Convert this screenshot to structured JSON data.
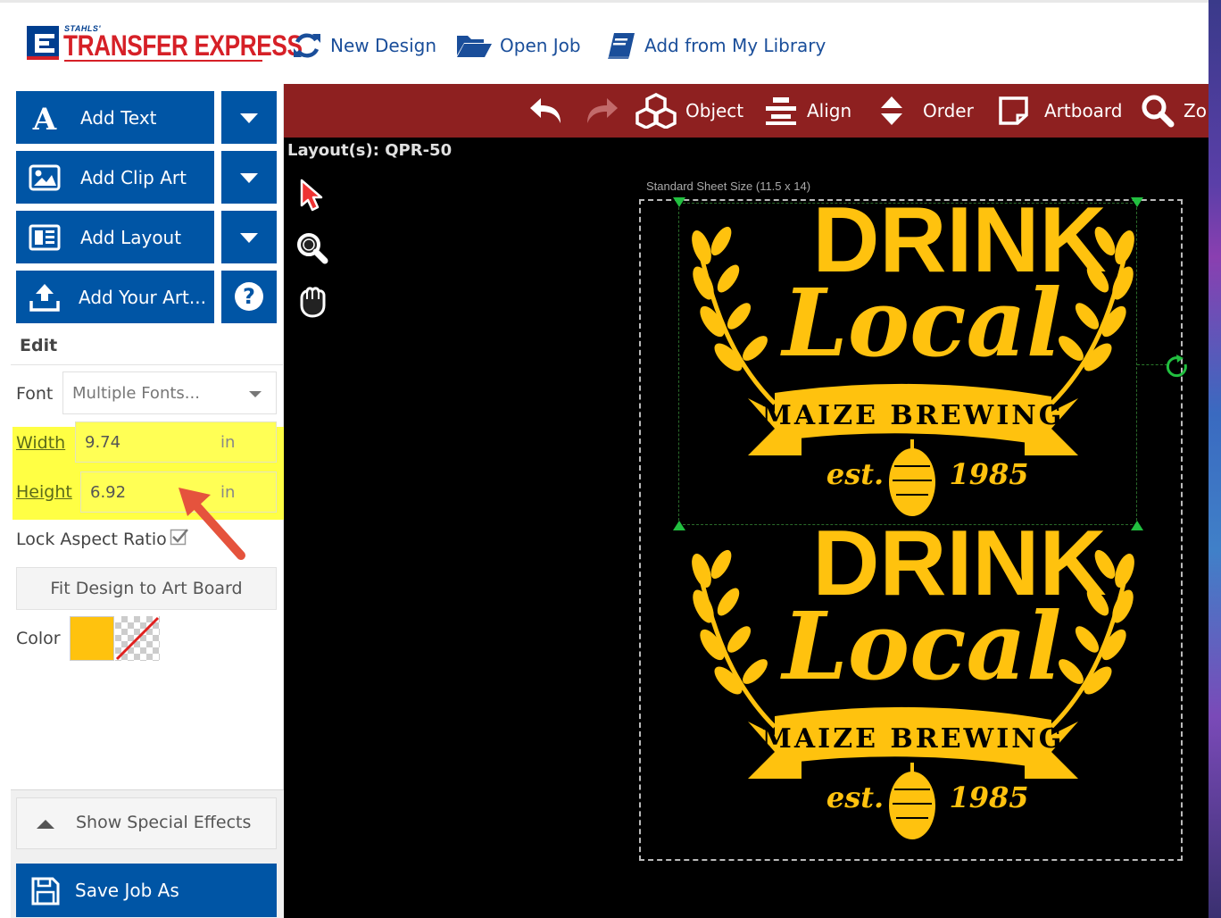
{
  "header": {
    "logo_small": "STAHLS'",
    "logo_big": "TRANSFER EXPRESS",
    "nav": [
      {
        "label": "New Design",
        "icon": "refresh-icon"
      },
      {
        "label": "Open Job",
        "icon": "folder-open-icon"
      },
      {
        "label": "Add from My Library",
        "icon": "book-icon"
      }
    ]
  },
  "sidebar": {
    "buttons": [
      {
        "label": "Add Text",
        "icon": "text-icon"
      },
      {
        "label": "Add Clip Art",
        "icon": "image-icon"
      },
      {
        "label": "Add Layout",
        "icon": "layout-icon"
      },
      {
        "label": "Add Your Art...",
        "icon": "upload-icon"
      }
    ],
    "help_label": "?",
    "edit_title": "Edit",
    "font_label": "Font",
    "font_value": "Multiple Fonts...",
    "width_label": "Width",
    "width_value": "9.74",
    "height_label": "Height",
    "height_value": "6.92",
    "unit": "in",
    "lock_label": "Lock Aspect Ratio",
    "lock_checked": true,
    "fit_label": "Fit Design to Art Board",
    "color_label": "Color",
    "color_value": "#FFC20E",
    "special_effects_label": "Show Special Effects",
    "save_label": "Save Job As"
  },
  "toolbar": {
    "items": [
      {
        "label": "Object",
        "icon": "cubes-icon"
      },
      {
        "label": "Align",
        "icon": "align-icon"
      },
      {
        "label": "Order",
        "icon": "order-icon"
      },
      {
        "label": "Artboard",
        "icon": "artboard-icon"
      },
      {
        "label": "Zo",
        "icon": "zoom-icon"
      }
    ]
  },
  "canvas": {
    "layout_label": "Layout(s): QPR-50",
    "sheet_label": "Standard Sheet Size (11.5 x 14)",
    "design": {
      "line1": "DRINK",
      "line2": "Local",
      "banner": "MAIZE BREWING",
      "est": "est.",
      "year": "1985"
    }
  },
  "colors": {
    "brand_blue": "#0055A5",
    "toolbar_red": "#8E2020",
    "design_yellow": "#FFC20E",
    "highlight_yellow": "#FFFF44",
    "annotation_red": "#E5533D"
  }
}
